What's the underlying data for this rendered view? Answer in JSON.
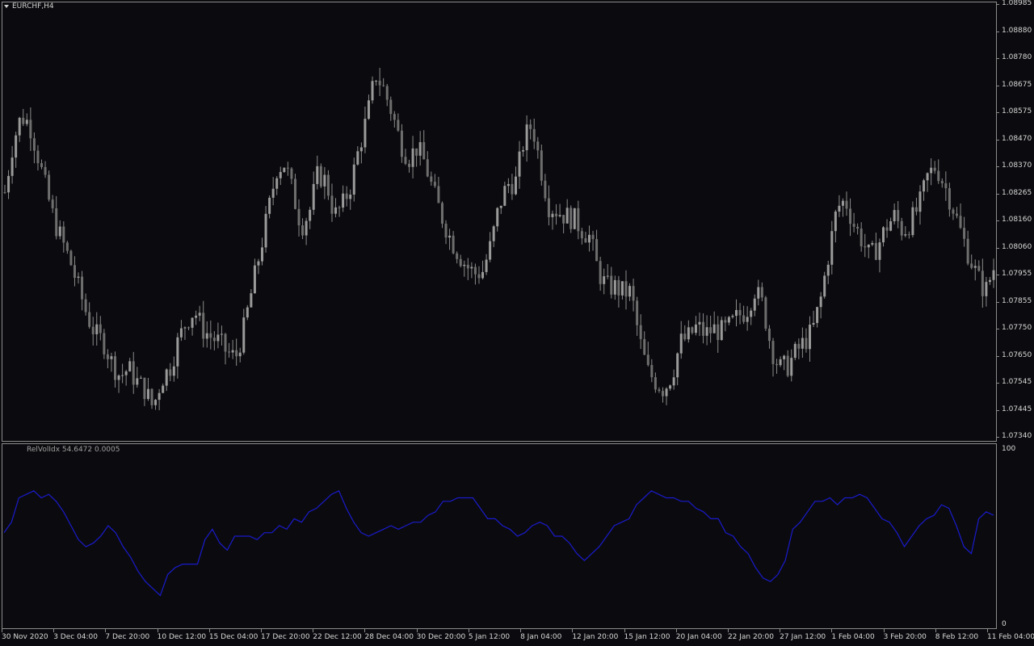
{
  "chart": {
    "symbol": "EURCHF,H4",
    "indicator_label": "RelVolIdx 54.6472 0.0005",
    "background": "#0b0b0f",
    "candle_color": "#8a8a8a",
    "line_color": "#1a1acc",
    "price_scale": [
      "1.08985",
      "1.08880",
      "1.08780",
      "1.08675",
      "1.08575",
      "1.08470",
      "1.08370",
      "1.08265",
      "1.08160",
      "1.08060",
      "1.07955",
      "1.07855",
      "1.07750",
      "1.07650",
      "1.07545",
      "1.07445",
      "1.07340"
    ],
    "indicator_scale": {
      "max": "100",
      "min": "0"
    },
    "time_scale": [
      "30 Nov 2020",
      "3 Dec 04:00",
      "7 Dec 20:00",
      "10 Dec 12:00",
      "15 Dec 04:00",
      "17 Dec 20:00",
      "22 Dec 12:00",
      "28 Dec 04:00",
      "30 Dec 20:00",
      "5 Jan 12:00",
      "8 Jan 04:00",
      "12 Jan 20:00",
      "15 Jan 12:00",
      "20 Jan 04:00",
      "22 Jan 20:00",
      "27 Jan 12:00",
      "1 Feb 04:00",
      "3 Feb 20:00",
      "8 Feb 12:00",
      "11 Feb 04:00"
    ]
  },
  "chart_data": {
    "type": "line",
    "price_series": {
      "name": "EURCHF,H4",
      "ylim": [
        1.0734,
        1.08985
      ],
      "close_path": [
        1.0827,
        1.0846,
        1.0856,
        1.0853,
        1.0841,
        1.0828,
        1.0816,
        1.0808,
        1.08,
        1.079,
        1.078,
        1.0773,
        1.077,
        1.0762,
        1.0757,
        1.076,
        1.0755,
        1.0752,
        1.0745,
        1.0756,
        1.076,
        1.077,
        1.0778,
        1.0782,
        1.0775,
        1.0772,
        1.077,
        1.0766,
        1.0764,
        1.0775,
        1.079,
        1.0805,
        1.082,
        1.0836,
        1.0838,
        1.0826,
        1.0814,
        1.082,
        1.0834,
        1.0831,
        1.0818,
        1.0822,
        1.083,
        1.0844,
        1.0856,
        1.0872,
        1.0866,
        1.0857,
        1.0846,
        1.084,
        1.0844,
        1.0838,
        1.0827,
        1.0818,
        1.081,
        1.0804,
        1.0799,
        1.0796,
        1.0797,
        1.0807,
        1.0822,
        1.083,
        1.0831,
        1.0847,
        1.0853,
        1.0837,
        1.0822,
        1.082,
        1.0818,
        1.0817,
        1.0813,
        1.081,
        1.0797,
        1.0791,
        1.0791,
        1.0789,
        1.0789,
        1.0771,
        1.0759,
        1.0755,
        1.0752,
        1.0758,
        1.077,
        1.0772,
        1.0776,
        1.0773,
        1.0775,
        1.0774,
        1.0776,
        1.078,
        1.0782,
        1.079,
        1.0784,
        1.0768,
        1.076,
        1.0761,
        1.0766,
        1.077,
        1.0774,
        1.0786,
        1.0804,
        1.0821,
        1.0824,
        1.0815,
        1.0809,
        1.0802,
        1.0807,
        1.0814,
        1.0818,
        1.0812,
        1.0816,
        1.0822,
        1.0833,
        1.0837,
        1.083,
        1.0822,
        1.0812,
        1.0803,
        1.0795,
        1.0789,
        1.0798
      ]
    },
    "indicator_series": {
      "name": "RelVolIdx",
      "ylim": [
        0,
        100
      ],
      "values": [
        52,
        58,
        72,
        74,
        76,
        72,
        74,
        70,
        64,
        56,
        48,
        44,
        46,
        50,
        56,
        52,
        44,
        38,
        30,
        24,
        20,
        16,
        28,
        32,
        34,
        34,
        34,
        48,
        54,
        46,
        42,
        50,
        50,
        50,
        48,
        52,
        52,
        56,
        54,
        60,
        58,
        64,
        66,
        70,
        74,
        76,
        66,
        58,
        52,
        50,
        52,
        54,
        56,
        54,
        56,
        58,
        58,
        62,
        64,
        70,
        70,
        72,
        72,
        72,
        66,
        60,
        60,
        56,
        54,
        50,
        52,
        56,
        58,
        56,
        50,
        50,
        46,
        40,
        36,
        40,
        44,
        50,
        56,
        58,
        60,
        68,
        72,
        76,
        74,
        72,
        72,
        70,
        70,
        66,
        64,
        60,
        60,
        52,
        50,
        44,
        40,
        32,
        26,
        24,
        28,
        36,
        54,
        58,
        64,
        70,
        70,
        72,
        68,
        72,
        72,
        74,
        72,
        66,
        60,
        58,
        52,
        44,
        50,
        56,
        60,
        62,
        68,
        66,
        56,
        44,
        40,
        60,
        64,
        62
      ]
    }
  }
}
